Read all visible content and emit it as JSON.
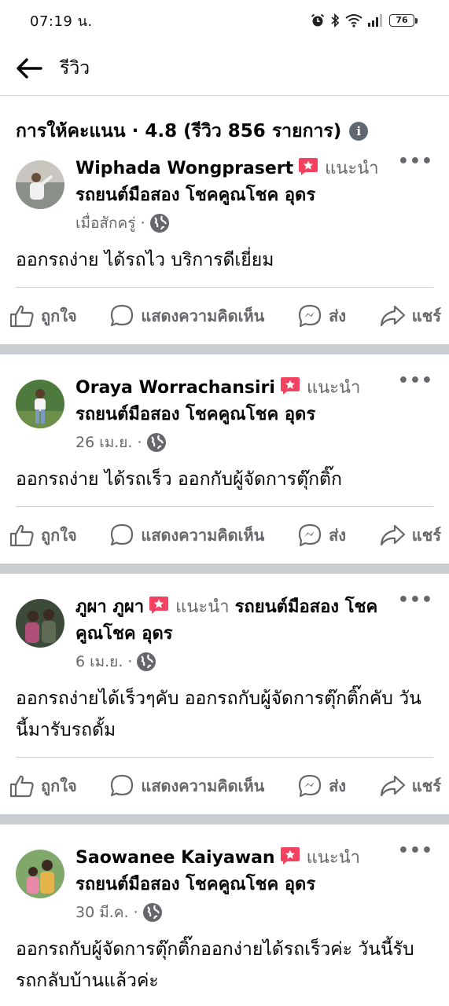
{
  "status_bar": {
    "time": "07:19 น.",
    "battery": "76"
  },
  "header": {
    "title": "รีวิว"
  },
  "summary": {
    "text": "การให้คะแนน · 4.8 (รีวิว 856 รายการ)"
  },
  "labels": {
    "recommend": "แนะนำ",
    "more": "•••"
  },
  "actions": {
    "like": "ถูกใจ",
    "comment": "แสดงความคิดเห็น",
    "send": "ส่ง",
    "share": "แชร์"
  },
  "reviews": [
    {
      "name": "Wiphada Wongprasert",
      "page": "รถยนต์มือสอง โชคคูณโชค อุดร",
      "time": "เมื่อสักครู่ ·",
      "text": "ออกรถง่าย ได้รถไว บริการดีเยี่ยม"
    },
    {
      "name": "Oraya Worrachansiri",
      "page": "รถยนต์มือสอง โชคคูณโชค อุดร",
      "time": "26 เม.ย. ·",
      "text": "ออกรถง่าย ได้รถเร็ว ออกกับผู้จัดการตุ๊กติ๊ก"
    },
    {
      "name": "ภูผา ภูผา",
      "page": "รถยนต์มือสอง โชคคูณโชค อุดร",
      "time": "6 เม.ย. ·",
      "text": "ออกรถง่ายได้เร็วๆคับ ออกรถกับผู้จัดการตุ๊กติ๊กคับ วันนี้มารับรถดั้ม"
    },
    {
      "name": "Saowanee Kaiyawan",
      "page": "รถยนต์มือสอง โชคคูณโชค อุดร",
      "time": "30 มี.ค. ·",
      "text": "ออกรถกับผู้จัดการตุ๊กติ๊กออกง่ายได้รถเร็วค่ะ วันนี้รับรถกลับบ้านแล้วค่ะ"
    }
  ],
  "colors": {
    "recommend_red": "#f3425f",
    "secondary_text": "#65676b",
    "separator": "#c9ccd1"
  }
}
